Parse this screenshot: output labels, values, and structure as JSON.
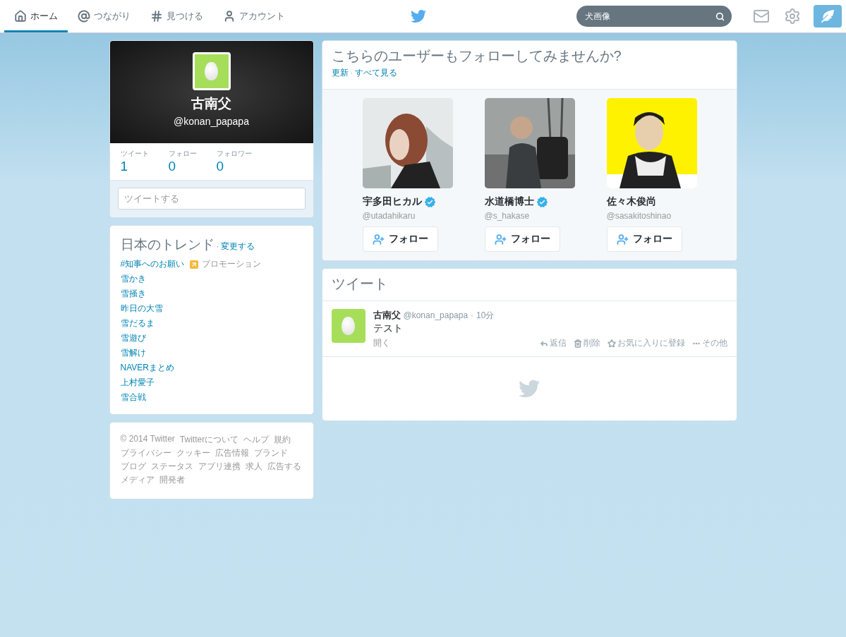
{
  "nav": {
    "tabs": [
      {
        "label": "ホーム",
        "kind": "home",
        "selected": true
      },
      {
        "label": "つながり",
        "kind": "at",
        "selected": false
      },
      {
        "label": "見つける",
        "kind": "hash",
        "selected": false
      },
      {
        "label": "アカウント",
        "kind": "user",
        "selected": false
      }
    ],
    "search": {
      "value": "犬画像"
    }
  },
  "profile": {
    "name": "古南父",
    "handle": "@konan_papapa",
    "stats": [
      {
        "label": "ツイート",
        "value": "1"
      },
      {
        "label": "フォロー",
        "value": "0"
      },
      {
        "label": "フォロワー",
        "value": "0"
      }
    ],
    "compose": {
      "placeholder": "ツイートする"
    }
  },
  "trends": {
    "title": "日本のトレンド",
    "separator": "·",
    "change_link": "変更する",
    "items": [
      {
        "label": "#知事へのお願い",
        "kind": "promoted",
        "note": "プロモーション"
      },
      {
        "label": "雪かき",
        "kind": "plain"
      },
      {
        "label": "雪掻き",
        "kind": "plain"
      },
      {
        "label": "昨日の大雪",
        "kind": "plain"
      },
      {
        "label": "雪だるま",
        "kind": "plain"
      },
      {
        "label": "雪遊び",
        "kind": "plain"
      },
      {
        "label": "雪解け",
        "kind": "plain"
      },
      {
        "label": "NAVERまとめ",
        "kind": "plain"
      },
      {
        "label": "上村愛子",
        "kind": "plain"
      },
      {
        "label": "雪合戦",
        "kind": "plain"
      }
    ]
  },
  "footer": {
    "links": [
      "© 2014 Twitter",
      "Twitterについて",
      "ヘルプ",
      "規約",
      "プライバシー",
      "クッキー",
      "広告情報",
      "ブランド",
      "ブログ",
      "ステータス",
      "アプリ連携",
      "求人",
      "広告する",
      "メディア",
      "開発者"
    ]
  },
  "suggestions": {
    "title": "こちらのユーザーもフォローしてみませんか?",
    "links": [
      "更新",
      "すべて見る"
    ],
    "separator": "·",
    "users": [
      {
        "name": "宇多田ヒカル",
        "handle": "@utadahikaru",
        "verified": true,
        "button": "フォロー"
      },
      {
        "name": "水道橋博士",
        "handle": "@s_hakase",
        "verified": true,
        "button": "フォロー"
      },
      {
        "name": "佐々木俊尚",
        "handle": "@sasakitoshinao",
        "verified": false,
        "button": "フォロー"
      }
    ]
  },
  "timeline": {
    "title": "ツイート",
    "tweets": [
      {
        "name": "古南父",
        "handle": "@konan_papapa",
        "separator": "·",
        "time": "10分",
        "text": "テスト",
        "open": "開く",
        "actions": [
          {
            "kind": "reply",
            "label": "返信"
          },
          {
            "kind": "delete",
            "label": "削除"
          },
          {
            "kind": "favorite",
            "label": "お気に入りに登録"
          },
          {
            "kind": "more",
            "label": "その他"
          }
        ]
      }
    ]
  }
}
